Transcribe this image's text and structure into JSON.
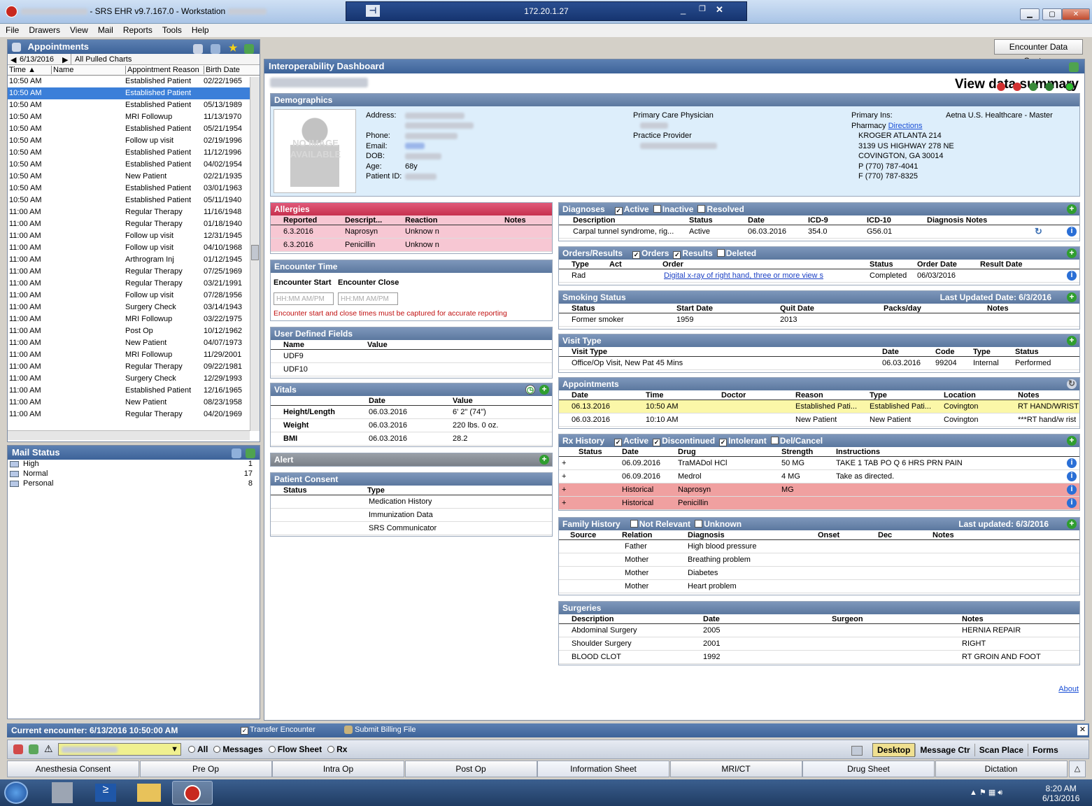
{
  "window": {
    "title": "SRS EHR v9.7.167.0 - Workstation",
    "rdp_ip": "172.20.1.27"
  },
  "menu": [
    "File",
    "Drawers",
    "View",
    "Mail",
    "Reports",
    "Tools",
    "Help"
  ],
  "appointments": {
    "title": "Appointments",
    "date": "6/13/2016",
    "filter": "All Pulled Charts",
    "columns": [
      "Time ▲",
      "Name",
      "Appointment Reason",
      "Birth Date"
    ],
    "rows": [
      [
        "10:50 AM",
        "Established Patient",
        "02/22/1965"
      ],
      [
        "10:50 AM",
        "Established Patient",
        ""
      ],
      [
        "10:50 AM",
        "Established Patient",
        "05/13/1989"
      ],
      [
        "10:50 AM",
        "MRI Followup",
        "11/13/1970"
      ],
      [
        "10:50 AM",
        "Established Patient",
        "05/21/1954"
      ],
      [
        "10:50 AM",
        "Follow up visit",
        "02/19/1996"
      ],
      [
        "10:50 AM",
        "Established Patient",
        "11/12/1996"
      ],
      [
        "10:50 AM",
        "Established Patient",
        "04/02/1954"
      ],
      [
        "10:50 AM",
        "New Patient",
        "02/21/1935"
      ],
      [
        "10:50 AM",
        "Established Patient",
        "03/01/1963"
      ],
      [
        "10:50 AM",
        "Established Patient",
        "05/11/1940"
      ],
      [
        "11:00 AM",
        "Regular Therapy",
        "11/16/1948"
      ],
      [
        "11:00 AM",
        "Regular Therapy",
        "01/18/1940"
      ],
      [
        "11:00 AM",
        "Follow up visit",
        "12/31/1945"
      ],
      [
        "11:00 AM",
        "Follow up visit",
        "04/10/1968"
      ],
      [
        "11:00 AM",
        "Arthrogram Inj",
        "01/12/1945"
      ],
      [
        "11:00 AM",
        "Regular Therapy",
        "07/25/1969"
      ],
      [
        "11:00 AM",
        "Regular Therapy",
        "03/21/1991"
      ],
      [
        "11:00 AM",
        "Follow up visit",
        "07/28/1956"
      ],
      [
        "11:00 AM",
        "Surgery Check",
        "03/14/1943"
      ],
      [
        "11:00 AM",
        "MRI Followup",
        "03/22/1975"
      ],
      [
        "11:00 AM",
        "Post Op",
        "10/12/1962"
      ],
      [
        "11:00 AM",
        "New Patient",
        "04/07/1973"
      ],
      [
        "11:00 AM",
        "MRI Followup",
        "11/29/2001"
      ],
      [
        "11:00 AM",
        "Regular Therapy",
        "09/22/1981"
      ],
      [
        "11:00 AM",
        "Surgery Check",
        "12/29/1993"
      ],
      [
        "11:00 AM",
        "Established Patient",
        "12/16/1965"
      ],
      [
        "11:00 AM",
        "New Patient",
        "08/23/1958"
      ],
      [
        "11:00 AM",
        "Regular Therapy",
        "04/20/1969"
      ]
    ]
  },
  "mail": {
    "title": "Mail Status",
    "items": [
      [
        "High",
        "1"
      ],
      [
        "Normal",
        "17"
      ],
      [
        "Personal",
        "8"
      ]
    ]
  },
  "encounter_capture_btn": "Encounter Data Capture",
  "dashboard": {
    "title": "Interoperability Dashboard",
    "view_summary": "View data summary",
    "demographics": {
      "title": "Demographics",
      "no_image": "NO IMAGE AVAILABLE",
      "labels": [
        "Address:",
        "Phone:",
        "Email:",
        "DOB:",
        "Age:",
        "Patient ID:"
      ],
      "age": "68y",
      "pcp_label": "Primary Care Physician",
      "practice_label": "Practice Provider",
      "ins_label": "Primary Ins:",
      "ins_value": "Aetna U.S. Healthcare - Master",
      "pharmacy_label": "Pharmacy",
      "directions": "Directions",
      "pharmacy": [
        "KROGER ATLANTA 214",
        "3139 US HIGHWAY 278 NE",
        "COVINGTON, GA 30014",
        "P (770) 787-4041",
        "F (770) 787-8325"
      ]
    },
    "allergies": {
      "title": "Allergies",
      "cols": [
        "Reported",
        "Descript...",
        "Reaction",
        "Notes"
      ],
      "rows": [
        [
          "6.3.2016",
          "Naprosyn",
          "Unknow n"
        ],
        [
          "6.3.2016",
          "Penicillin",
          "Unknow n"
        ]
      ]
    },
    "encounter_time": {
      "title": "Encounter Time",
      "start": "Encounter Start",
      "close": "Encounter Close",
      "ph": "HH:MM AM/PM",
      "warn": "Encounter start and close times must be captured for accurate reporting"
    },
    "udf": {
      "title": "User Defined Fields",
      "cols": [
        "Name",
        "Value"
      ],
      "rows": [
        "UDF9",
        "UDF10"
      ]
    },
    "vitals": {
      "title": "Vitals",
      "cols": [
        "Date",
        "Value"
      ],
      "rows": [
        [
          "Height/Length",
          "06.03.2016",
          "6' 2\" (74\")"
        ],
        [
          "Weight",
          "06.03.2016",
          "220 lbs. 0 oz."
        ],
        [
          "BMI",
          "06.03.2016",
          "28.2"
        ]
      ]
    },
    "alert": {
      "title": "Alert"
    },
    "consent": {
      "title": "Patient Consent",
      "cols": [
        "Status",
        "Type"
      ],
      "rows": [
        [
          "ok",
          "Medication History"
        ],
        [
          "q",
          "Immunization Data"
        ],
        [
          "ok",
          "SRS Communicator"
        ]
      ]
    },
    "diagnoses": {
      "title": "Diagnoses",
      "filters": [
        "Active",
        "Inactive",
        "Resolved"
      ],
      "cols": [
        "Description",
        "Status",
        "Date",
        "ICD-9",
        "ICD-10",
        "Diagnosis Notes"
      ],
      "row": [
        "Carpal tunnel syndrome, rig...",
        "Active",
        "06.03.2016",
        "354.0",
        "G56.01"
      ]
    },
    "orders": {
      "title": "Orders/Results",
      "filters": [
        "Orders",
        "Results",
        "Deleted"
      ],
      "cols": [
        "Type",
        "Act",
        "Order",
        "Status",
        "Order Date",
        "Result Date"
      ],
      "row": [
        "Rad",
        "Digital x-ray of right hand, three or more view s",
        "Completed",
        "06/03/2016"
      ]
    },
    "smoking": {
      "title": "Smoking Status",
      "updated": "Last Updated Date: 6/3/2016",
      "cols": [
        "Status",
        "Start Date",
        "Quit Date",
        "Packs/day",
        "Notes"
      ],
      "row": [
        "Former smoker",
        "1959",
        "2013"
      ]
    },
    "visit": {
      "title": "Visit Type",
      "cols": [
        "Visit Type",
        "Date",
        "Code",
        "Type",
        "Status"
      ],
      "row": [
        "Office/Op Visit, New  Pat 45 Mins",
        "06.03.2016",
        "99204",
        "Internal",
        "Performed"
      ]
    },
    "appts": {
      "title": "Appointments",
      "cols": [
        "Date",
        "Time",
        "Doctor",
        "Reason",
        "Type",
        "Location",
        "Notes"
      ],
      "rows": [
        [
          "06.13.2016",
          "10:50 AM",
          "Established Pati...",
          "Established Pati...",
          "Covington",
          "RT HAND/WRIST"
        ],
        [
          "06.03.2016",
          "10:10 AM",
          "New  Patient",
          "New  Patient",
          "Covington",
          "***RT hand/w rist"
        ]
      ]
    },
    "rx": {
      "title": "Rx History",
      "filters": [
        "Active",
        "Discontinued",
        "Intolerant",
        "Del/Cancel"
      ],
      "cols": [
        "Status",
        "Date",
        "Drug",
        "Strength",
        "Instructions"
      ],
      "rows": [
        [
          "06.09.2016",
          "TraMADol HCl",
          "50 MG",
          "TAKE 1 TAB PO Q 6 HRS PRN PAIN"
        ],
        [
          "06.09.2016",
          "Medrol",
          "4 MG",
          "Take as directed."
        ],
        [
          "Historical",
          "Naprosyn",
          "MG",
          ""
        ],
        [
          "Historical",
          "Penicillin",
          "",
          ""
        ]
      ]
    },
    "family": {
      "title": "Family History",
      "filters": [
        "Not Relevant",
        "Unknown"
      ],
      "updated": "Last updated: 6/3/2016",
      "cols": [
        "Source",
        "Relation",
        "Diagnosis",
        "Onset",
        "Dec",
        "Notes"
      ],
      "rows": [
        [
          "Father",
          "High blood pressure"
        ],
        [
          "Mother",
          "Breathing problem"
        ],
        [
          "Mother",
          "Diabetes"
        ],
        [
          "Mother",
          "Heart problem"
        ]
      ]
    },
    "surgeries": {
      "title": "Surgeries",
      "cols": [
        "Description",
        "Date",
        "Surgeon",
        "Notes"
      ],
      "rows": [
        [
          "Abdominal Surgery",
          "2005",
          "HERNIA REPAIR"
        ],
        [
          "Shoulder Surgery",
          "2001",
          "RIGHT"
        ],
        [
          "BLOOD CLOT",
          "1992",
          "RT GROIN AND FOOT"
        ]
      ]
    },
    "about": "About"
  },
  "bottom": {
    "current": "Current encounter:  6/13/2016 10:50:00 AM",
    "transfer": "Transfer Encounter",
    "billing": "Submit Billing File",
    "radios": [
      "All",
      "Messages",
      "Flow Sheet",
      "Rx"
    ],
    "right": [
      "Desktop",
      "Message Ctr",
      "Scan Place",
      "Forms"
    ],
    "tabs": [
      "Anesthesia Consent",
      "Pre Op",
      "Intra Op",
      "Post Op",
      "Information Sheet",
      "MRI/CT",
      "Drug Sheet",
      "Dictation"
    ]
  },
  "clock": {
    "time": "8:20 AM",
    "date": "6/13/2016"
  },
  "colors": {
    "header": "#3d6399",
    "section": "#5b789f",
    "allergy": "#c7304e",
    "selected": "#3b7fd9"
  }
}
